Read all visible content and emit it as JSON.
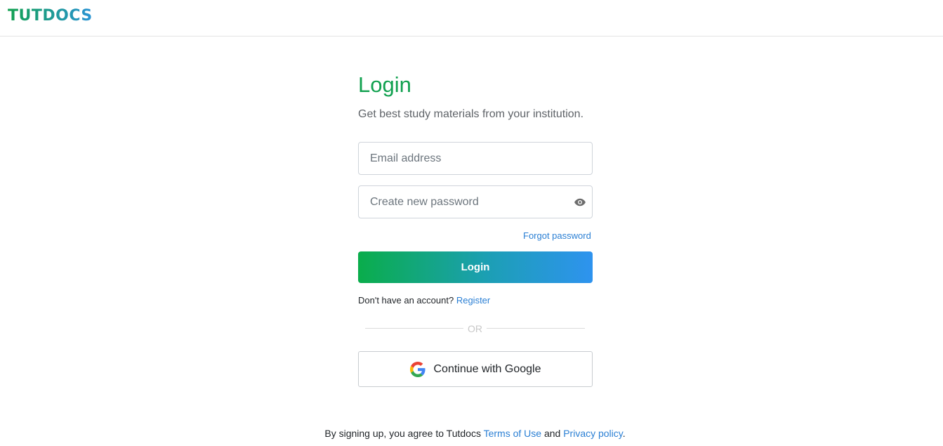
{
  "header": {
    "logo_text": "TUTDOCS"
  },
  "login": {
    "title": "Login",
    "subtitle": "Get best study materials from your institution.",
    "email_placeholder": "Email address",
    "password_placeholder": "Create new password",
    "forgot_label": "Forgot password",
    "button_label": "Login",
    "no_account_text": "Don't have an account?",
    "register_label": "Register",
    "or_label": "OR",
    "google_label": "Continue with Google"
  },
  "footer": {
    "prefix": "By signing up, you agree to Tutdocs",
    "terms_label": "Terms of Use",
    "and_text": "and",
    "privacy_label": "Privacy policy",
    "suffix": "."
  },
  "colors": {
    "brand_green": "#12a150",
    "brand_blue": "#2a93d5",
    "link_blue": "#2a7fd4"
  },
  "icons": {
    "password_toggle": "eye-icon",
    "google": "google-icon"
  }
}
